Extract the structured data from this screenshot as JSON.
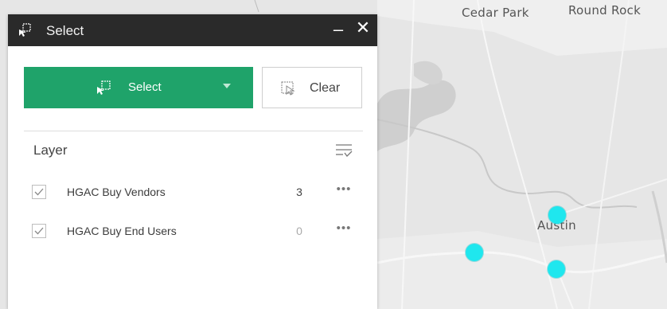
{
  "map": {
    "labels": {
      "cedar_park": "Cedar Park",
      "round_rock": "Round Rock",
      "austin": "Austin"
    },
    "poi_color": "#1fe7ee"
  },
  "panel": {
    "title": "Select",
    "title_icon": "select-tool-icon",
    "minimize_glyph": "–",
    "close_glyph": "✕",
    "select_button": {
      "label": "Select",
      "icon": "select-tool-icon",
      "color": "#1fa36a"
    },
    "clear_button": {
      "label": "Clear",
      "icon": "clear-selection-icon"
    },
    "layer_header": "Layer",
    "filter_icon": "filter-list-icon",
    "layers": [
      {
        "name": "HGAC Buy Vendors",
        "count": "3",
        "checked": true,
        "count_color": "#444444"
      },
      {
        "name": "HGAC Buy End Users",
        "count": "0",
        "checked": true,
        "count_color": "#aaaaaa"
      }
    ],
    "more_glyph": "•••"
  }
}
